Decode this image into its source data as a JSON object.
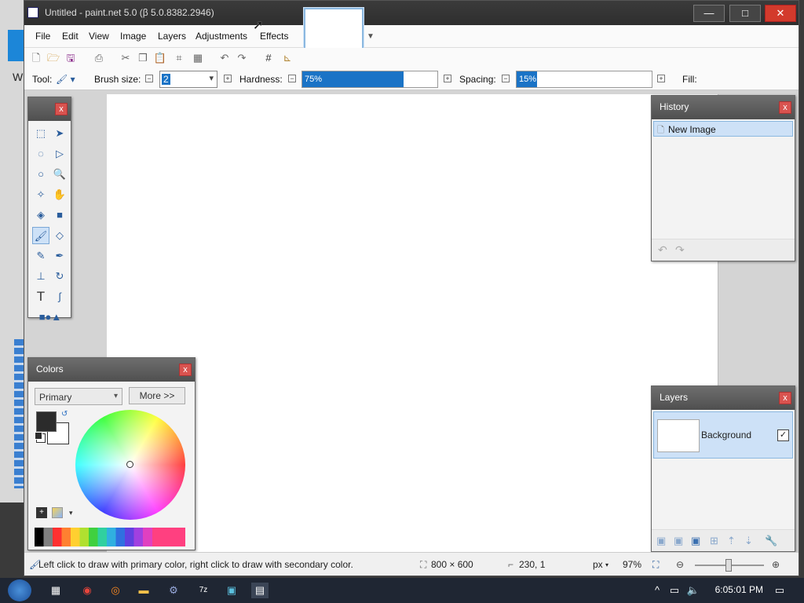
{
  "window": {
    "title": "Untitled - paint.net 5.0 (β 5.0.8382.2946)",
    "min_glyph": "—",
    "max_glyph": "□",
    "close_glyph": "✕"
  },
  "background_window": {
    "letter": "W"
  },
  "menu": [
    "File",
    "Edit",
    "View",
    "Image",
    "Layers",
    "Adjustments",
    "Effects"
  ],
  "options": {
    "tool_label": "Tool:",
    "brush_size_label": "Brush size:",
    "brush_size_value": "2",
    "hardness_label": "Hardness:",
    "hardness_value": "75%",
    "hardness_fraction": 0.75,
    "spacing_label": "Spacing:",
    "spacing_value": "15%",
    "spacing_fraction": 0.15,
    "fill_label": "Fill:"
  },
  "history": {
    "title": "History",
    "items": [
      "New Image"
    ]
  },
  "layers": {
    "title": "Layers",
    "items": [
      {
        "name": "Background",
        "visible": true
      }
    ]
  },
  "colors": {
    "title": "Colors",
    "select_value": "Primary",
    "more_label": "More >>",
    "primary": "#2b2b2b",
    "secondary": "#ffffff"
  },
  "status": {
    "hint": "Left click to draw with primary color, right click to draw with secondary color.",
    "image_size": "800 × 600",
    "cursor_pos": "230, 1",
    "units": "px",
    "zoom": "97%"
  },
  "taskbar": {
    "clock": "6:05:01 PM"
  },
  "accent": "#1a73c6"
}
